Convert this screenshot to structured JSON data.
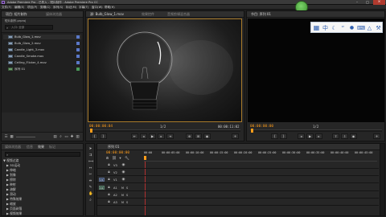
{
  "window": {
    "title": "Adobe Premiere Pro - 已导入 - 短片制作 - Adobe Premiere Pro CC",
    "controls": [
      "–",
      "□",
      "×"
    ]
  },
  "menu": [
    "文件(F)",
    "编辑(E)",
    "项目(P)",
    "剪辑(C)",
    "序列(S)",
    "标记(M)",
    "字幕(T)",
    "窗口(W)",
    "帮助(H)"
  ],
  "project_panel": {
    "tabs": [
      "项目: 短片制作",
      "媒体浏览器"
    ],
    "path": "短片制作.prproj",
    "search_placeholder": "入口: 全部",
    "files": [
      "Bulb_Glow_1.mov",
      "Bulb_Glow_2.mov",
      "Candle_Light_3.mov",
      "Candle_Smoke.mov",
      "Ceiling_Flicker_4.mov",
      "序列 01"
    ]
  },
  "source_monitor": {
    "tabs": [
      "源: Bulb_Glow_1.mov",
      "效果控件",
      "音频剪辑混合器"
    ],
    "timecode_current": "00:00:00:04",
    "fit": "1/2",
    "timecode_duration": "00:00:11:02"
  },
  "program_monitor": {
    "tab": "节目: 序列 01",
    "timecode_current": "00:00:00:00",
    "fit": "1/2"
  },
  "toolbar_float": {
    "icons": [
      "grid-icon",
      "chinese-input-icon",
      "moon-icon",
      "comma-icon",
      "mic-icon",
      "keyboard-icon",
      "shirt-icon",
      "wrench-icon"
    ],
    "glyphs": [
      "▦",
      "中",
      "☾",
      "“",
      "●",
      "⌨",
      "△",
      "⚒"
    ]
  },
  "effects_panel": {
    "tabs": [
      "媒体浏览器",
      "信息",
      "效果",
      "标记"
    ],
    "tree": [
      "▼ 视频过渡",
      "  ▶ 3D运动",
      "  ▶ 伸缩",
      "  ▶ 划像",
      "  ▶ 擦除",
      "  ▶ 映射",
      "  ▶ 溶解",
      "  ▶ 滑动",
      "  ▶ 特殊效果",
      "  ▶ 缩放",
      "  ▶ 页面剥落",
      "  ▶ 视频效果"
    ]
  },
  "timeline": {
    "tab": "序列 01",
    "timecode": "00:00:00:00",
    "ruler": [
      "00:00",
      "00:00:05:00",
      "00:00:10:00",
      "00:00:15:00",
      "00:00:20:00",
      "00:00:25:00",
      "00:00:30:00",
      "00:00:35:00",
      "00:00:40:00",
      "00:00:45:00"
    ],
    "tracks": [
      "V3",
      "V2",
      "V1",
      "A1",
      "A2",
      "A3"
    ]
  },
  "colors": {
    "accent_timecode": "#ff9d1a",
    "label_blue": "#5a78c8",
    "panel": "#262626",
    "float_toolbar_icons": "#2f5fb0"
  }
}
